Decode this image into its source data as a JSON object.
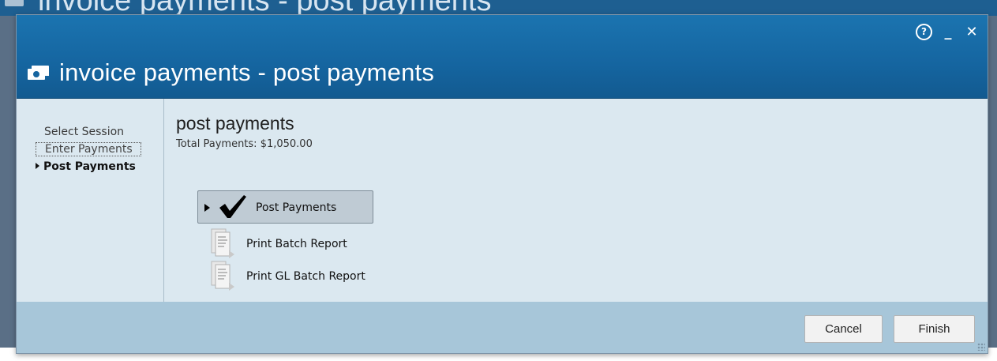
{
  "background_window": {
    "title": "invoice payments - post payments"
  },
  "dialog": {
    "title": "invoice payments - post payments",
    "controls": {
      "help": "?",
      "minimize": "_",
      "close": "✕"
    }
  },
  "steps": [
    {
      "label": "Select Session",
      "state": "done"
    },
    {
      "label": "Enter Payments",
      "state": "focused"
    },
    {
      "label": "Post Payments",
      "state": "current"
    }
  ],
  "main": {
    "heading": "post payments",
    "total_label": "Total Payments: $1,050.00",
    "actions": [
      {
        "label": "Post Payments",
        "icon": "checkmark-icon",
        "selected": true
      },
      {
        "label": "Print Batch Report",
        "icon": "report-document-icon"
      },
      {
        "label": "Print GL Batch Report",
        "icon": "report-document-icon"
      }
    ]
  },
  "footer": {
    "cancel_label": "Cancel",
    "finish_label": "Finish"
  },
  "colors": {
    "header_blue": "#1565a0",
    "dialog_body": "#dbe8f0",
    "footer": "#a7c6d9",
    "selected_action": "#bfcbd4"
  }
}
